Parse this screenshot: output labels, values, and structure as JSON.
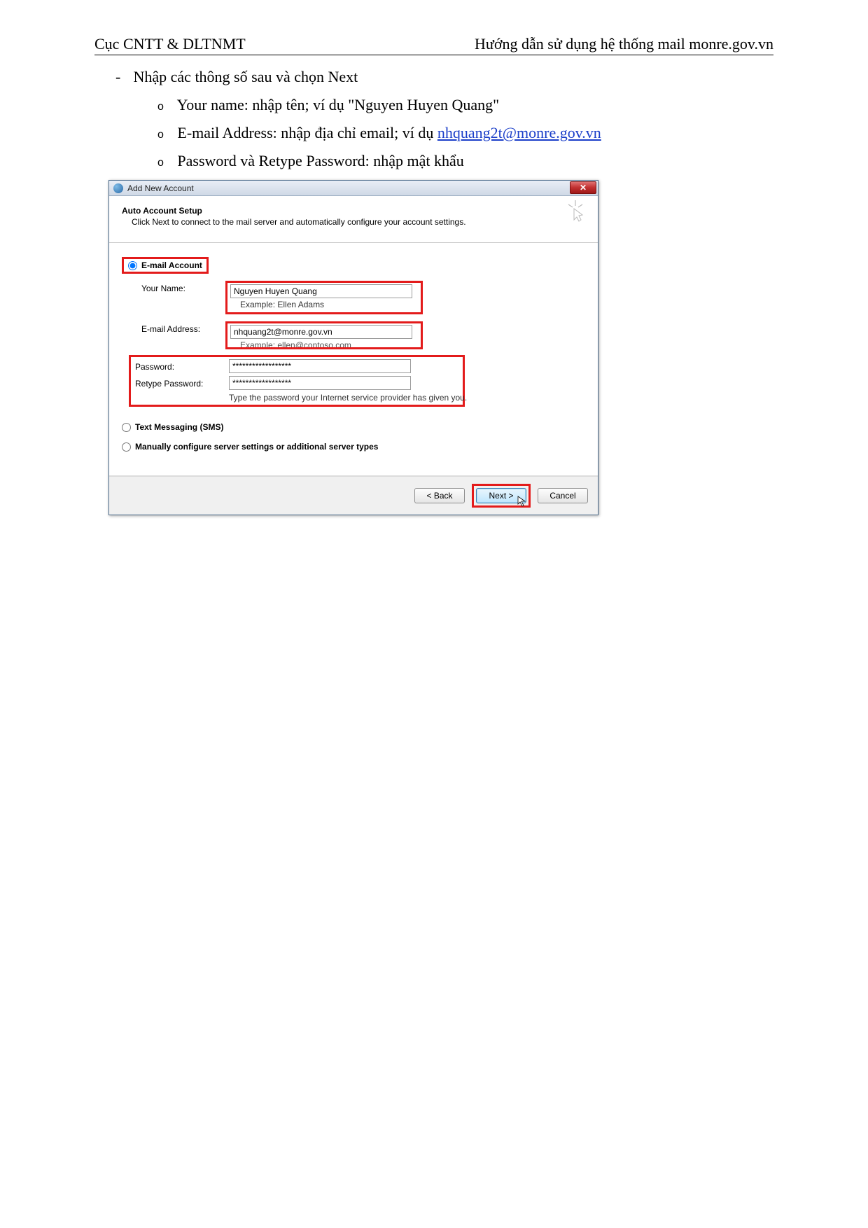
{
  "header": {
    "left": "Cục CNTT & DLTNMT",
    "right": "Hướng dẫn sử dụng hệ thống mail monre.gov.vn"
  },
  "instructions": {
    "main": "Nhập các thông số sau và chọn Next",
    "items": [
      "Your name: nhập tên; ví dụ \"Nguyen Huyen Quang\"",
      "E-mail Address: nhập địa chỉ email; ví dụ  ",
      "Password và Retype Password: nhập mật khẩu"
    ],
    "email_link": "nhquang2t@monre.gov.vn"
  },
  "dialog": {
    "title": "Add New Account",
    "setup_title": "Auto Account Setup",
    "setup_desc": "Click Next to connect to the mail server and automatically configure your account settings.",
    "options": {
      "email_account": "E-mail Account",
      "sms": "Text Messaging (SMS)",
      "manual": "Manually configure server settings or additional server types"
    },
    "fields": {
      "your_name_label": "Your Name:",
      "your_name_value": "Nguyen Huyen Quang",
      "your_name_example": "Example: Ellen Adams",
      "email_label": "E-mail Address:",
      "email_value": "nhquang2t@monre.gov.vn",
      "email_example": "Example: ellen@contoso.com",
      "password_label": "Password:",
      "password_value": "******************",
      "retype_label": "Retype Password:",
      "retype_value": "******************",
      "password_hint": "Type the password your Internet service provider has given you."
    },
    "buttons": {
      "back": "< Back",
      "next": "Next >",
      "cancel": "Cancel"
    }
  }
}
